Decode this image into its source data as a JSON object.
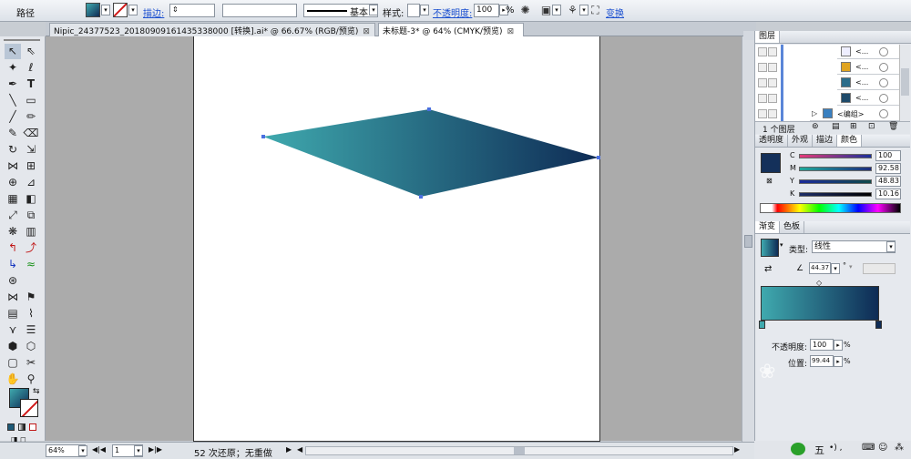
{
  "control_bar": {
    "path_label": "路径",
    "stroke_label": "描边:",
    "stroke_style": "基本",
    "style_label": "样式:",
    "opacity_label": "不透明度:",
    "opacity_value": "100",
    "opacity_unit": "%",
    "transform_label": "变换",
    "fill_color": "#1e5a78"
  },
  "tabs": [
    {
      "label": "Nipic_24377523_20180909161435338000 [转换].ai* @ 66.67% (RGB/预览)",
      "close": "⊠"
    },
    {
      "label": "未标题-3* @ 64% (CMYK/预览)",
      "close": "⊠"
    }
  ],
  "status": {
    "zoom": "64%",
    "page": "1",
    "undo_text": "52 次还原；无重做"
  },
  "layers_panel": {
    "title": "图层",
    "rows": [
      "<...",
      "<...",
      "<...",
      "<...",
      "<编组>"
    ],
    "footer_count": "1 个图层"
  },
  "color_panel": {
    "tabs": [
      "透明度",
      "外观",
      "描边",
      "颜色"
    ],
    "active_tab": "颜色",
    "channels": [
      {
        "name": "C",
        "value": "100",
        "grad": "linear-gradient(90deg,#fff,#00a0e0)"
      },
      {
        "name": "M",
        "value": "92.58",
        "grad": "linear-gradient(90deg,#00a0e0,#1c2b7e)"
      },
      {
        "name": "Y",
        "value": "48.83",
        "grad": "linear-gradient(90deg,#1a2a9a,#0f2e4a)"
      },
      {
        "name": "K",
        "value": "10.16",
        "grad": "linear-gradient(90deg,#1c2d68,#000)"
      }
    ],
    "current_color": "#14305a"
  },
  "gradient_panel": {
    "tabs": [
      "渐变",
      "色板"
    ],
    "type_label": "类型:",
    "type_value": "线性",
    "angle": "44.37",
    "angle_unit": "°",
    "opacity_label": "不透明度:",
    "opacity_value": "100",
    "location_label": "位置:",
    "location_value": "99.44",
    "unit": "%",
    "start_color": "#3fa9ae",
    "end_color": "#0e2b55"
  },
  "icons": {
    "ime_label": "五",
    "ime_symbols": "•) ,"
  }
}
